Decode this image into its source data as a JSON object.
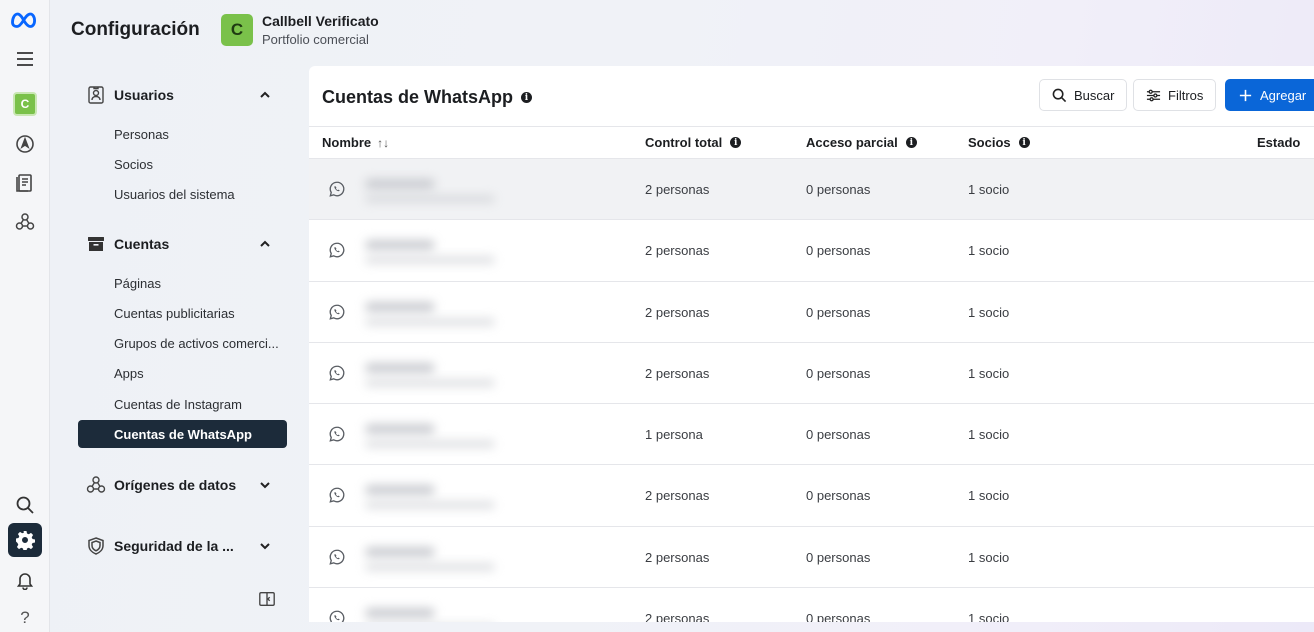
{
  "header": {
    "title": "Configuración",
    "business_initial": "C",
    "business_name": "Callbell Verificato",
    "business_sub": "Portfolio comercial"
  },
  "rail": {
    "avatar_initial": "C",
    "items": [
      "meta-logo-icon",
      "menu-icon",
      "business-avatar",
      "compass-icon",
      "pages-icon",
      "network-icon",
      "search-icon",
      "settings-icon",
      "bell-icon",
      "help-icon"
    ],
    "help_label": "?"
  },
  "sidebar": {
    "sections": [
      {
        "label": "Usuarios",
        "expanded": true,
        "items": [
          "Personas",
          "Socios",
          "Usuarios del sistema"
        ]
      },
      {
        "label": "Cuentas",
        "expanded": true,
        "items": [
          "Páginas",
          "Cuentas publicitarias",
          "Grupos de activos comerci...",
          "Apps",
          "Cuentas de Instagram",
          "Cuentas de WhatsApp"
        ]
      },
      {
        "label": "Orígenes de datos",
        "expanded": false
      },
      {
        "label": "Seguridad de la ...",
        "expanded": false
      }
    ],
    "selected": "Cuentas de WhatsApp"
  },
  "main": {
    "title": "Cuentas de WhatsApp",
    "info_glyph": "i",
    "buttons": {
      "search": "Buscar",
      "filters": "Filtros",
      "add": "Agregar"
    },
    "columns": {
      "name": "Nombre",
      "sort_glyph": "↑↓",
      "full_control": "Control total",
      "partial_access": "Acceso parcial",
      "partners": "Socios",
      "status": "Estado"
    },
    "rows": [
      {
        "full_control": "2 personas",
        "partial_access": "0 personas",
        "partners": "1 socio"
      },
      {
        "full_control": "2 personas",
        "partial_access": "0 personas",
        "partners": "1 socio"
      },
      {
        "full_control": "2 personas",
        "partial_access": "0 personas",
        "partners": "1 socio"
      },
      {
        "full_control": "2 personas",
        "partial_access": "0 personas",
        "partners": "1 socio"
      },
      {
        "full_control": "1 persona",
        "partial_access": "0 personas",
        "partners": "1 socio"
      },
      {
        "full_control": "2 personas",
        "partial_access": "0 personas",
        "partners": "1 socio"
      },
      {
        "full_control": "2 personas",
        "partial_access": "0 personas",
        "partners": "1 socio"
      },
      {
        "full_control": "2 personas",
        "partial_access": "0 personas",
        "partners": "1 socio"
      }
    ]
  },
  "colors": {
    "accent": "#0a66d8",
    "selected_nav": "#1c2b3a",
    "avatar_green": "#7ac14a"
  }
}
